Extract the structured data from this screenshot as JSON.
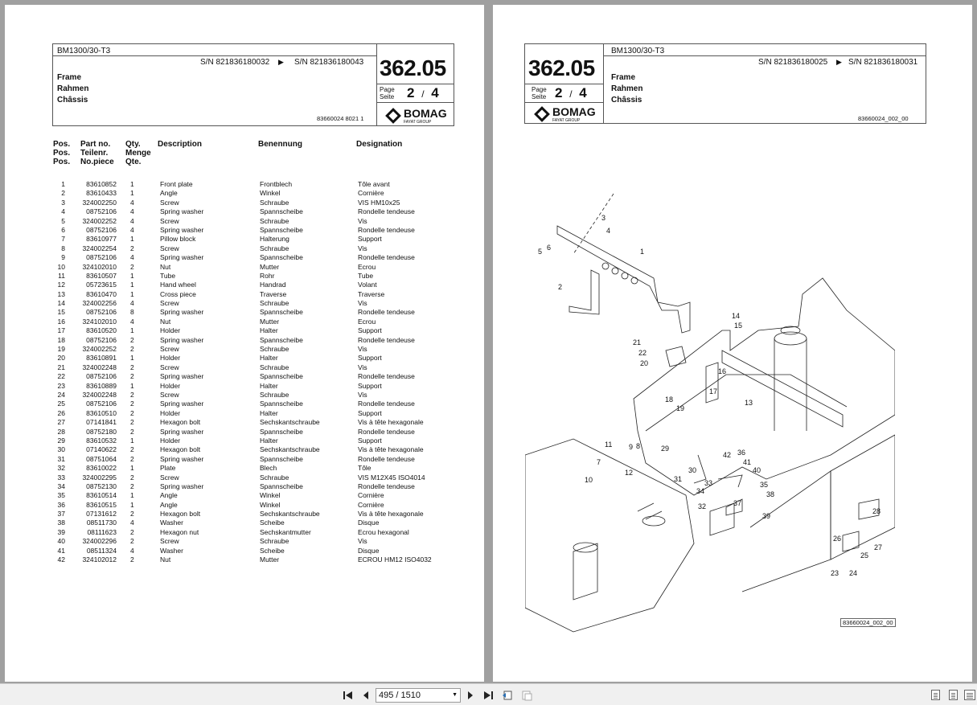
{
  "left_page": {
    "model": "BM1300/30-T3",
    "sn_from": "S/N 821836180032",
    "sn_to": "S/N 821836180043",
    "group_number": "362.05",
    "title_en": "Frame",
    "title_de": "Rahmen",
    "title_fr": "Châssis",
    "page_label_en": "Page",
    "page_label_de": "Seite",
    "page_current": "2",
    "page_sep": "/",
    "page_total": "4",
    "doc_ref": "83660024 8021 1",
    "brand": "BOMAG",
    "brand_sub": "FAYAT GROUP",
    "columns": {
      "pos": [
        "Pos.",
        "Pos.",
        "Pos."
      ],
      "part": [
        "Part no.",
        "Teilenr.",
        "No.piece"
      ],
      "qty": [
        "Qty.",
        "Menge",
        "Qte."
      ],
      "description": "Description",
      "benennung": "Benennung",
      "designation": "Designation"
    },
    "parts": [
      {
        "pos": "1",
        "part": "83610852",
        "qty": "1",
        "desc": "Front plate",
        "ben": "Frontblech",
        "des": "Tôle avant"
      },
      {
        "pos": "2",
        "part": "83610433",
        "qty": "1",
        "desc": "Angle",
        "ben": "Winkel",
        "des": "Cornière"
      },
      {
        "pos": "3",
        "part": "324002250",
        "qty": "4",
        "desc": "Screw",
        "ben": "Schraube",
        "des": "VIS HM10x25"
      },
      {
        "pos": "4",
        "part": "08752106",
        "qty": "4",
        "desc": "Spring washer",
        "ben": "Spannscheibe",
        "des": "Rondelle tendeuse"
      },
      {
        "pos": "5",
        "part": "324002252",
        "qty": "4",
        "desc": "Screw",
        "ben": "Schraube",
        "des": "Vis"
      },
      {
        "pos": "6",
        "part": "08752106",
        "qty": "4",
        "desc": "Spring washer",
        "ben": "Spannscheibe",
        "des": "Rondelle tendeuse"
      },
      {
        "pos": "7",
        "part": "83610977",
        "qty": "1",
        "desc": "Pillow block",
        "ben": "Halterung",
        "des": "Support"
      },
      {
        "pos": "8",
        "part": "324002254",
        "qty": "2",
        "desc": "Screw",
        "ben": "Schraube",
        "des": "Vis"
      },
      {
        "pos": "9",
        "part": "08752106",
        "qty": "4",
        "desc": "Spring washer",
        "ben": "Spannscheibe",
        "des": "Rondelle tendeuse"
      },
      {
        "pos": "10",
        "part": "324102010",
        "qty": "2",
        "desc": "Nut",
        "ben": "Mutter",
        "des": "Ecrou"
      },
      {
        "pos": "11",
        "part": "83610507",
        "qty": "1",
        "desc": "Tube",
        "ben": "Rohr",
        "des": "Tube"
      },
      {
        "pos": "12",
        "part": "05723615",
        "qty": "1",
        "desc": "Hand wheel",
        "ben": "Handrad",
        "des": "Volant"
      },
      {
        "pos": "13",
        "part": "83610470",
        "qty": "1",
        "desc": "Cross piece",
        "ben": "Traverse",
        "des": "Traverse"
      },
      {
        "pos": "14",
        "part": "324002256",
        "qty": "4",
        "desc": "Screw",
        "ben": "Schraube",
        "des": "Vis"
      },
      {
        "pos": "15",
        "part": "08752106",
        "qty": "8",
        "desc": "Spring washer",
        "ben": "Spannscheibe",
        "des": "Rondelle tendeuse"
      },
      {
        "pos": "16",
        "part": "324102010",
        "qty": "4",
        "desc": "Nut",
        "ben": "Mutter",
        "des": "Ecrou"
      },
      {
        "pos": "17",
        "part": "83610520",
        "qty": "1",
        "desc": "Holder",
        "ben": "Halter",
        "des": "Support"
      },
      {
        "pos": "18",
        "part": "08752106",
        "qty": "2",
        "desc": "Spring washer",
        "ben": "Spannscheibe",
        "des": "Rondelle tendeuse"
      },
      {
        "pos": "19",
        "part": "324002252",
        "qty": "2",
        "desc": "Screw",
        "ben": "Schraube",
        "des": "Vis"
      },
      {
        "pos": "20",
        "part": "83610891",
        "qty": "1",
        "desc": "Holder",
        "ben": "Halter",
        "des": "Support"
      },
      {
        "pos": "21",
        "part": "324002248",
        "qty": "2",
        "desc": "Screw",
        "ben": "Schraube",
        "des": "Vis"
      },
      {
        "pos": "22",
        "part": "08752106",
        "qty": "2",
        "desc": "Spring washer",
        "ben": "Spannscheibe",
        "des": "Rondelle tendeuse"
      },
      {
        "pos": "23",
        "part": "83610889",
        "qty": "1",
        "desc": "Holder",
        "ben": "Halter",
        "des": "Support"
      },
      {
        "pos": "24",
        "part": "324002248",
        "qty": "2",
        "desc": "Screw",
        "ben": "Schraube",
        "des": "Vis"
      },
      {
        "pos": "25",
        "part": "08752106",
        "qty": "2",
        "desc": "Spring washer",
        "ben": "Spannscheibe",
        "des": "Rondelle tendeuse"
      },
      {
        "pos": "26",
        "part": "83610510",
        "qty": "2",
        "desc": "Holder",
        "ben": "Halter",
        "des": "Support"
      },
      {
        "pos": "27",
        "part": "07141841",
        "qty": "2",
        "desc": "Hexagon bolt",
        "ben": "Sechskantschraube",
        "des": "Vis à tête hexagonale"
      },
      {
        "pos": "28",
        "part": "08752180",
        "qty": "2",
        "desc": "Spring washer",
        "ben": "Spannscheibe",
        "des": "Rondelle tendeuse"
      },
      {
        "pos": "29",
        "part": "83610532",
        "qty": "1",
        "desc": "Holder",
        "ben": "Halter",
        "des": "Support"
      },
      {
        "pos": "30",
        "part": "07140622",
        "qty": "2",
        "desc": "Hexagon bolt",
        "ben": "Sechskantschraube",
        "des": "Vis à tête hexagonale"
      },
      {
        "pos": "31",
        "part": "08751064",
        "qty": "2",
        "desc": "Spring washer",
        "ben": "Spannscheibe",
        "des": "Rondelle tendeuse"
      },
      {
        "pos": "32",
        "part": "83610022",
        "qty": "1",
        "desc": "Plate",
        "ben": "Blech",
        "des": "Tôle"
      },
      {
        "pos": "33",
        "part": "324002295",
        "qty": "2",
        "desc": "Screw",
        "ben": "Schraube",
        "des": "VIS M12X45 ISO4014"
      },
      {
        "pos": "34",
        "part": "08752130",
        "qty": "2",
        "desc": "Spring washer",
        "ben": "Spannscheibe",
        "des": "Rondelle tendeuse"
      },
      {
        "pos": "35",
        "part": "83610514",
        "qty": "1",
        "desc": "Angle",
        "ben": "Winkel",
        "des": "Cornière"
      },
      {
        "pos": "36",
        "part": "83610515",
        "qty": "1",
        "desc": "Angle",
        "ben": "Winkel",
        "des": "Cornière"
      },
      {
        "pos": "37",
        "part": "07131612",
        "qty": "2",
        "desc": "Hexagon bolt",
        "ben": "Sechskantschraube",
        "des": "Vis à tête hexagonale"
      },
      {
        "pos": "38",
        "part": "08511730",
        "qty": "4",
        "desc": "Washer",
        "ben": "Scheibe",
        "des": "Disque"
      },
      {
        "pos": "39",
        "part": "08111623",
        "qty": "2",
        "desc": "Hexagon nut",
        "ben": "Sechskantmutter",
        "des": "Ecrou hexagonal"
      },
      {
        "pos": "40",
        "part": "324002296",
        "qty": "2",
        "desc": "Screw",
        "ben": "Schraube",
        "des": "Vis"
      },
      {
        "pos": "41",
        "part": "08511324",
        "qty": "4",
        "desc": "Washer",
        "ben": "Scheibe",
        "des": "Disque"
      },
      {
        "pos": "42",
        "part": "324102012",
        "qty": "2",
        "desc": "Nut",
        "ben": "Mutter",
        "des": "ECROU HM12 ISO4032"
      }
    ]
  },
  "right_page": {
    "model": "BM1300/30-T3",
    "sn_from": "S/N 821836180025",
    "sn_to": "S/N 821836180031",
    "group_number": "362.05",
    "title_en": "Frame",
    "title_de": "Rahmen",
    "title_fr": "Châssis",
    "page_label_en": "Page",
    "page_label_de": "Seite",
    "page_current": "2",
    "page_sep": "/",
    "page_total": "4",
    "doc_ref": "83660024_002_00",
    "brand": "BOMAG",
    "brand_sub": "FAYAT GROUP",
    "drawing_ref": "83660024_002_00",
    "callouts": [
      "1",
      "2",
      "3",
      "4",
      "5",
      "6",
      "7",
      "8",
      "9",
      "10",
      "11",
      "12",
      "13",
      "14",
      "15",
      "16",
      "17",
      "18",
      "19",
      "20",
      "21",
      "22",
      "23",
      "24",
      "25",
      "26",
      "27",
      "28",
      "29",
      "30",
      "31",
      "32",
      "33",
      "34",
      "35",
      "36",
      "37",
      "38",
      "39",
      "40",
      "41",
      "42"
    ]
  },
  "toolbar": {
    "page_field": "495 / 1510",
    "first_icon": "first-page-icon",
    "prev_icon": "prev-page-icon",
    "next_icon": "next-page-icon",
    "last_icon": "last-page-icon"
  },
  "colors": {
    "viewer_bg": "#a0a0a0",
    "toolbar_bg": "#f0f0f0",
    "page_bg": "#ffffff"
  }
}
